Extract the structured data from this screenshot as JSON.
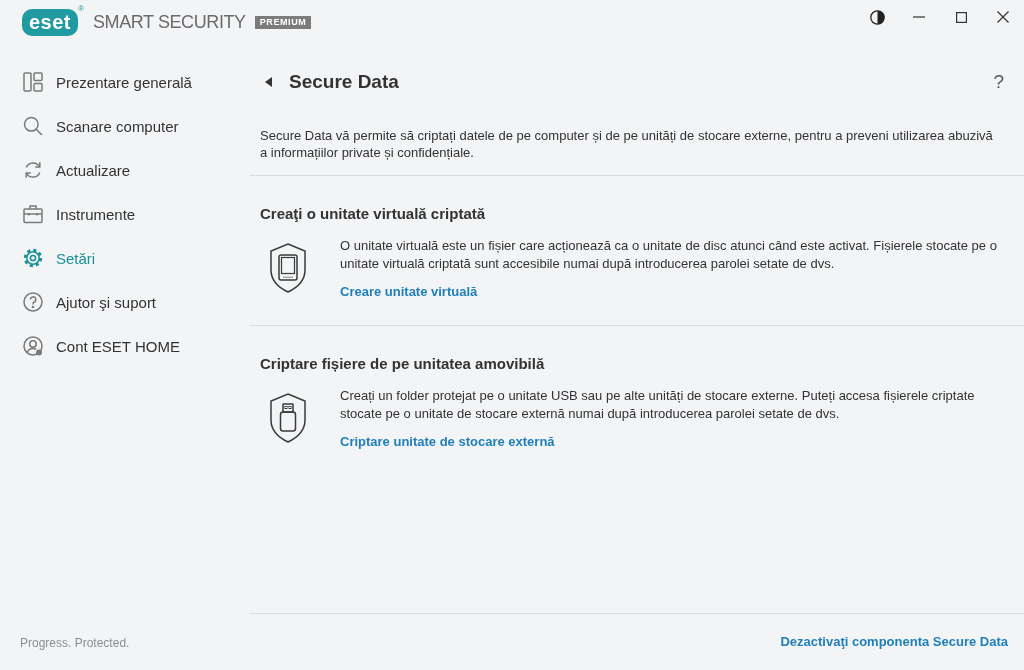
{
  "logo": {
    "mark": "eset",
    "registered": "®",
    "product": "SMART SECURITY",
    "edition": "PREMIUM"
  },
  "sidebar": {
    "items": [
      {
        "label": "Prezentare generală",
        "selected": false
      },
      {
        "label": "Scanare computer",
        "selected": false
      },
      {
        "label": "Actualizare",
        "selected": false
      },
      {
        "label": "Instrumente",
        "selected": false
      },
      {
        "label": "Setări",
        "selected": true
      },
      {
        "label": "Ajutor şi suport",
        "selected": false
      },
      {
        "label": "Cont ESET HOME",
        "selected": false
      }
    ],
    "tagline": "Progress. Protected."
  },
  "page": {
    "title": "Secure Data",
    "help": "?",
    "description": "Secure Data vă permite să criptați datele de pe computer și de pe unități de stocare externe, pentru a preveni utilizarea abuzivă a informațiilor private și confidențiale.",
    "sections": [
      {
        "title": "Creaţi o unitate virtuală criptată",
        "text": "O unitate virtuală este un fișier care acționează ca o unitate de disc atunci când este activat. Fișierele stocate pe o unitate virtuală criptată sunt accesibile numai după introducerea parolei setate de dvs.",
        "link": "Creare unitate virtuală"
      },
      {
        "title": "Criptare fișiere de pe unitatea amovibilă",
        "text": "Creați un folder protejat pe o unitate USB sau pe alte unități de stocare externe. Puteți accesa fișierele criptate stocate pe o unitate de stocare externă numai după introducerea parolei setate de dvs.",
        "link": "Criptare unitate de stocare externă"
      }
    ],
    "footer_link": "Dezactivaţi componenta Secure Data"
  }
}
